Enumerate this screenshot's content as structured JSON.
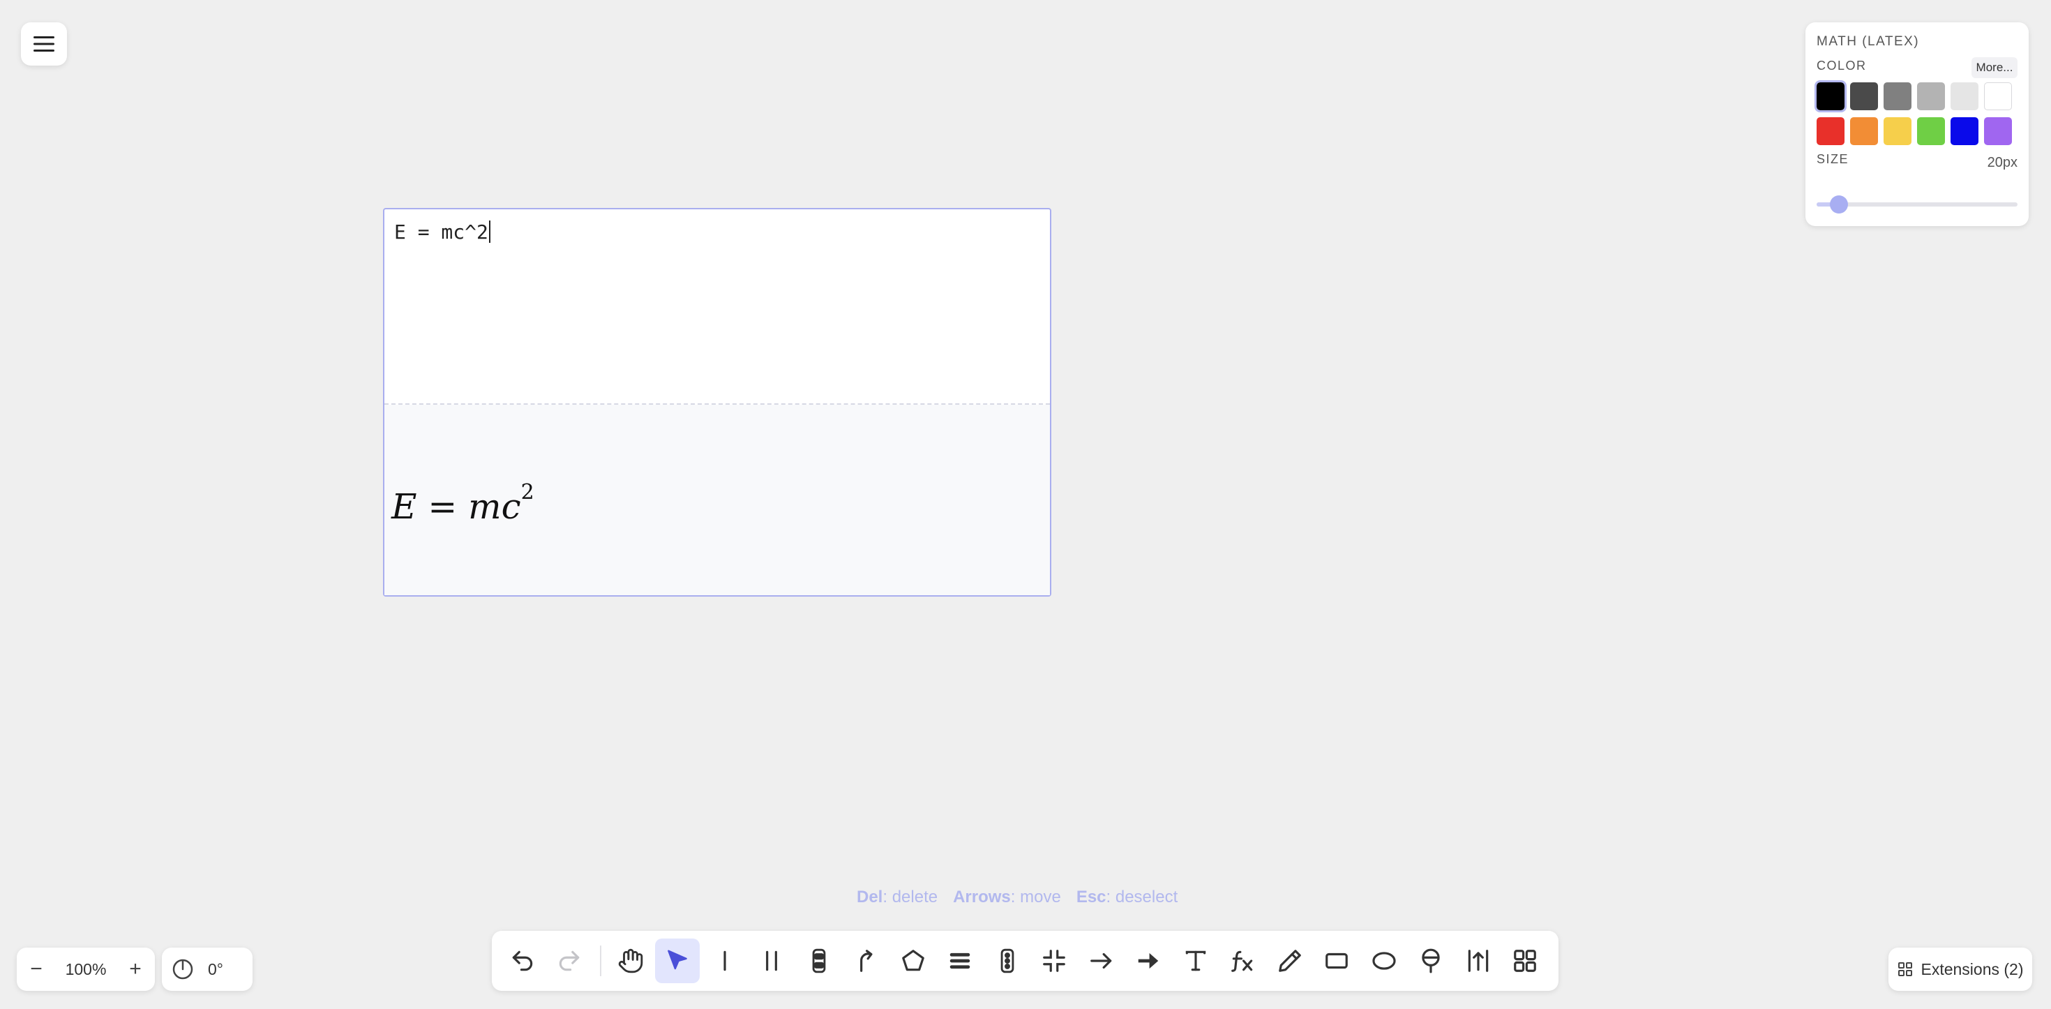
{
  "properties": {
    "title": "MATH (LATEX)",
    "color_label": "COLOR",
    "more_label": "More...",
    "size_label": "SIZE",
    "size_value": "20px",
    "slider_fraction": 0.11,
    "selected_color": "#000000",
    "colors": [
      "#000000",
      "#4a4a4a",
      "#808080",
      "#b3b3b3",
      "#e5e5e5",
      "#ffffff",
      "#e8302a",
      "#f28d35",
      "#f6cf4b",
      "#6fcf45",
      "#0a0aea",
      "#a066f0"
    ]
  },
  "math": {
    "source": "E = mc^2",
    "rendered_base": "E = mc",
    "rendered_exponent": "2"
  },
  "hints": [
    {
      "key": "Del",
      "action": ": delete"
    },
    {
      "key": "Arrows",
      "action": ": move"
    },
    {
      "key": "Esc",
      "action": ": deselect"
    }
  ],
  "zoom": {
    "value": "100%",
    "minus_label": "−",
    "plus_label": "+"
  },
  "rotation": {
    "value": "0°"
  },
  "extensions": {
    "label": "Extensions (2)"
  },
  "toolbar": {
    "active_tool": "select",
    "tools": [
      "undo",
      "redo",
      "hand",
      "select",
      "line",
      "double-line",
      "vehicle",
      "curved-arrow",
      "polygon",
      "stack",
      "traffic-light",
      "compress",
      "arrow",
      "thick-arrow",
      "text",
      "function",
      "pencil",
      "rectangle",
      "ellipse",
      "pin",
      "measure",
      "grid"
    ]
  }
}
